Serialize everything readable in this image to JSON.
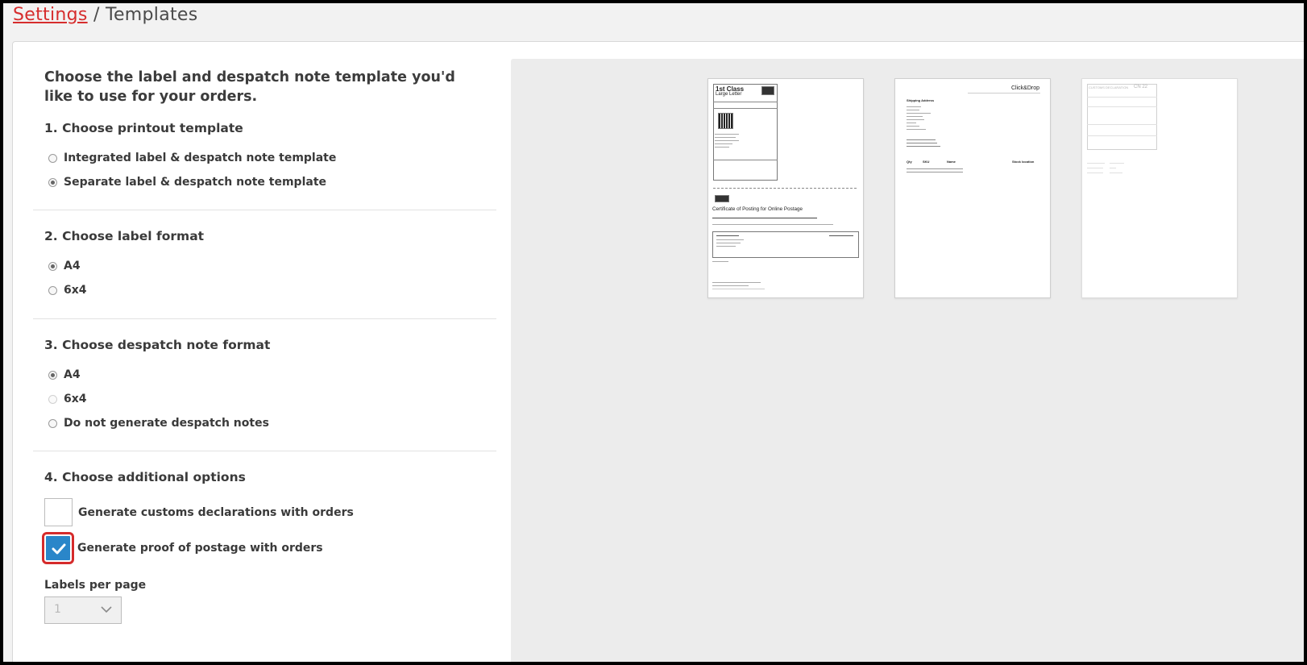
{
  "breadcrumb": {
    "settings_link": "Settings",
    "separator": "/",
    "current": "Templates"
  },
  "intro": "Choose the label and despatch note template you'd like to use for your orders.",
  "section1": {
    "heading": "1. Choose printout template",
    "options": [
      {
        "label": "Integrated label & despatch note template",
        "selected": false
      },
      {
        "label": "Separate label & despatch note template",
        "selected": true
      }
    ]
  },
  "section2": {
    "heading": "2. Choose label format",
    "options": [
      {
        "label": "A4",
        "selected": true
      },
      {
        "label": "6x4",
        "selected": false
      }
    ]
  },
  "section3": {
    "heading": "3. Choose despatch note format",
    "options": [
      {
        "label": "A4",
        "selected": true
      },
      {
        "label": "6x4",
        "selected": false,
        "disabled": true
      },
      {
        "label": "Do not generate despatch notes",
        "selected": false
      }
    ]
  },
  "section4": {
    "heading": "4. Choose additional options",
    "options": [
      {
        "label": "Generate customs declarations with orders",
        "checked": false
      },
      {
        "label": "Generate proof of postage with orders",
        "checked": true
      }
    ],
    "labels_per_page_label": "Labels per page",
    "labels_per_page_value": "1"
  },
  "preview": {
    "label_thumb": {
      "service": "1st Class",
      "format": "Large Letter",
      "certificate_title": "Certificate of Posting for Online Postage",
      "brand": "Royal Mail"
    },
    "despatch_thumb": {
      "brand": "Click&Drop",
      "shipping_address_heading": "Shipping Address",
      "col_qty": "Qty",
      "col_sku": "SKU",
      "col_name": "Name",
      "col_stock": "Stock location"
    },
    "customs_thumb": {
      "title": "CUSTOMS DECLARATION",
      "code": "CN 22"
    }
  },
  "colors": {
    "link_red": "#d62d2d",
    "accent_blue": "#2a86c9",
    "focus_red": "#d52b2b"
  }
}
